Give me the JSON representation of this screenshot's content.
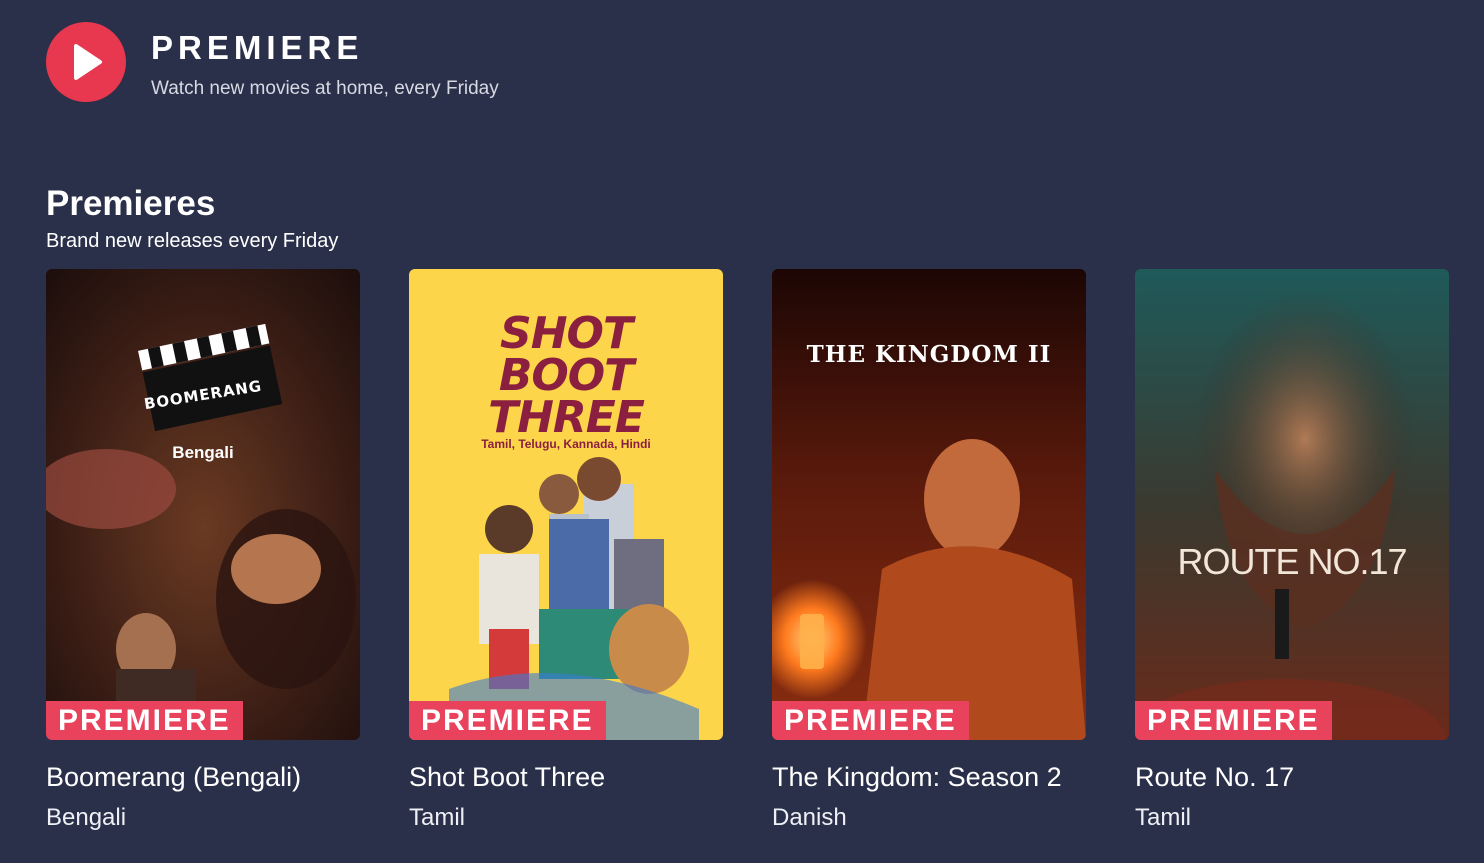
{
  "header": {
    "logo_icon": "play-icon",
    "title": "PREMIERE",
    "tagline": "Watch new movies at home, every Friday"
  },
  "section": {
    "title": "Premieres",
    "subtitle": "Brand new releases every Friday"
  },
  "colors": {
    "background": "#2b304a",
    "accent": "#e7384f",
    "badge": "#e8425c"
  },
  "movies": [
    {
      "title": "Boomerang (Bengali)",
      "language": "Bengali",
      "badge": "PREMIERE",
      "poster_title": "BOOMERANG",
      "poster_subtitle": "Bengali"
    },
    {
      "title": "Shot Boot Three",
      "language": "Tamil",
      "badge": "PREMIERE",
      "poster_title_lines": [
        "SHOT",
        "BOOT",
        "THREE"
      ],
      "poster_subtitle": "Tamil, Telugu, Kannada, Hindi"
    },
    {
      "title": "The Kingdom: Season 2",
      "language": "Danish",
      "badge": "PREMIERE",
      "poster_title": "THE KINGDOM II"
    },
    {
      "title": "Route No. 17",
      "language": "Tamil",
      "badge": "PREMIERE",
      "poster_title": "ROUTE NO.17"
    }
  ]
}
